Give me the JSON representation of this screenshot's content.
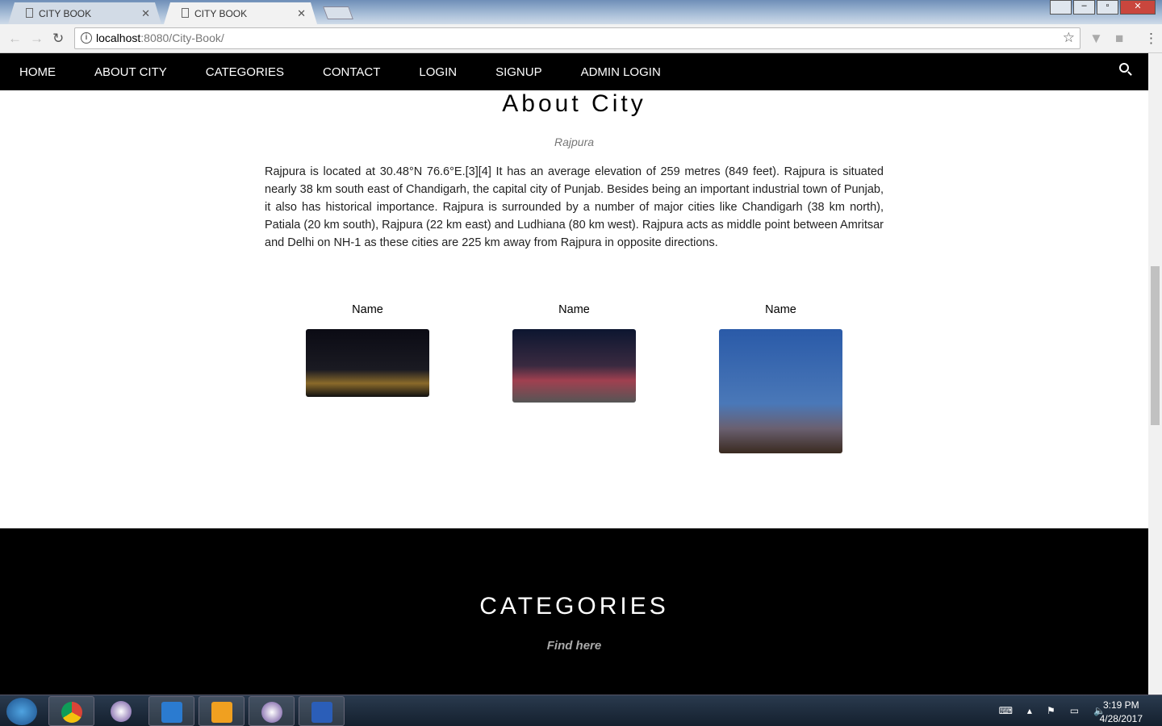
{
  "browser": {
    "tabs": [
      {
        "title": "CITY BOOK"
      },
      {
        "title": "CITY BOOK"
      }
    ],
    "url_host": "localhost",
    "url_path": ":8080/City-Book/"
  },
  "nav": {
    "items": [
      "HOME",
      "ABOUT CITY",
      "CATEGORIES",
      "CONTACT",
      "LOGIN",
      "SIGNUP",
      "ADMIN LOGIN"
    ]
  },
  "about": {
    "title": "About City",
    "subtitle": "Rajpura",
    "text": "Rajpura is located at 30.48°N 76.6°E.[3][4] It has an average elevation of 259 metres (849 feet). Rajpura is situated nearly 38 km south east of Chandigarh, the capital city of Punjab. Besides being an important industrial town of Punjab, it also has historical importance. Rajpura is surrounded by a number of major cities like Chandigarh (38 km north), Patiala (20 km south), Rajpura (22 km east) and Ludhiana (80 km west). Rajpura acts as middle point between Amritsar and Delhi on NH-1 as these cities are 225 km away from Rajpura in opposite directions.",
    "cards": [
      {
        "name": "Name"
      },
      {
        "name": "Name"
      },
      {
        "name": "Name"
      }
    ]
  },
  "categories": {
    "title": "CATEGORIES",
    "subtitle": "Find here"
  },
  "taskbar": {
    "time": "3:19 PM",
    "date": "4/28/2017"
  }
}
